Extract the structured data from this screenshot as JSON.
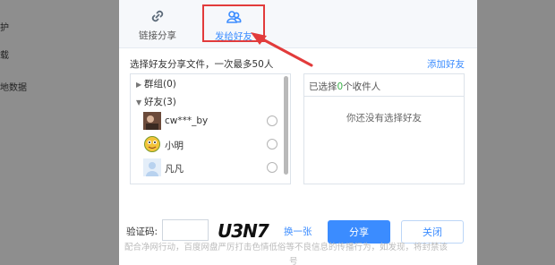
{
  "background": {
    "left_items": [
      "护",
      "载",
      "地数据"
    ]
  },
  "dialog": {
    "tabs": [
      {
        "label": "链接分享",
        "icon": "link-icon",
        "active": false
      },
      {
        "label": "发给好友",
        "icon": "friends-icon",
        "active": true
      }
    ],
    "hint": "选择好友分享文件，一次最多50人",
    "add_friend": "添加好友",
    "groups_label": "群组(0)",
    "friends_label": "好友(3)",
    "friends": [
      {
        "name": "cw***_by",
        "avatar_color": "#6b4a3a"
      },
      {
        "name": "小明",
        "avatar_color": "#f3c43a"
      },
      {
        "name": "凡凡",
        "avatar_color": "#cfe3f6"
      }
    ],
    "selected_prefix": "已选择",
    "selected_count": "0",
    "selected_suffix": "个收件人",
    "empty_text": "你还没有选择好友",
    "captcha_label": "验证码:",
    "captcha_value": "",
    "captcha_text": "U3N7",
    "refresh": "换一张",
    "share_button": "分享",
    "close_button": "关闭",
    "notice": "配合净网行动，百度网盘严厉打击色情低俗等不良信息的传播行为，如发现，将封禁该",
    "notice_tail": "号"
  },
  "colors": {
    "accent": "#3b8cff",
    "annotation": "#e23b3b",
    "count": "#3bb14a"
  }
}
